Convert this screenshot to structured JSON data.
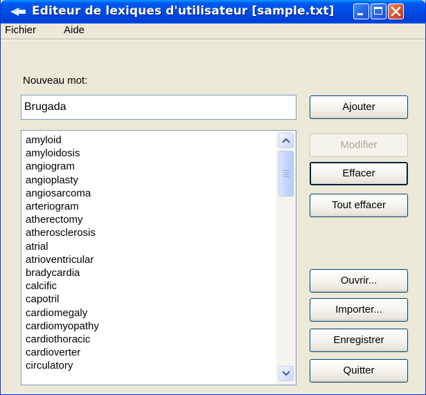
{
  "window": {
    "title": "Editeur de lexiques d'utilisateur [sample.txt]",
    "title_icon": "⬰"
  },
  "menu": {
    "items": [
      {
        "label": "Fichier"
      },
      {
        "label": "Aide"
      }
    ]
  },
  "form": {
    "new_word_label": "Nouveau mot:",
    "new_word_value": "Brugada"
  },
  "word_list": [
    "amyloid",
    "amyloidosis",
    "angiogram",
    "angioplasty",
    "angiosarcoma",
    "arteriogram",
    "atherectomy",
    "atherosclerosis",
    "atrial",
    "atrioventricular",
    "bradycardia",
    "calcific",
    "capotril",
    "cardiomegaly",
    "cardiomyopathy",
    "cardiothoracic",
    "cardioverter",
    "circulatory"
  ],
  "buttons": {
    "add": "Ajouter",
    "modify": "Modifier",
    "delete": "Effacer",
    "delete_all": "Tout effacer",
    "open": "Ouvrir...",
    "import": "Importer...",
    "save": "Enregistrer",
    "quit": "Quitter"
  },
  "colors": {
    "titlebar": "#0054e3",
    "window_bg": "#ece9d8",
    "close_button": "#d8502c",
    "disabled_text": "#aca899"
  }
}
